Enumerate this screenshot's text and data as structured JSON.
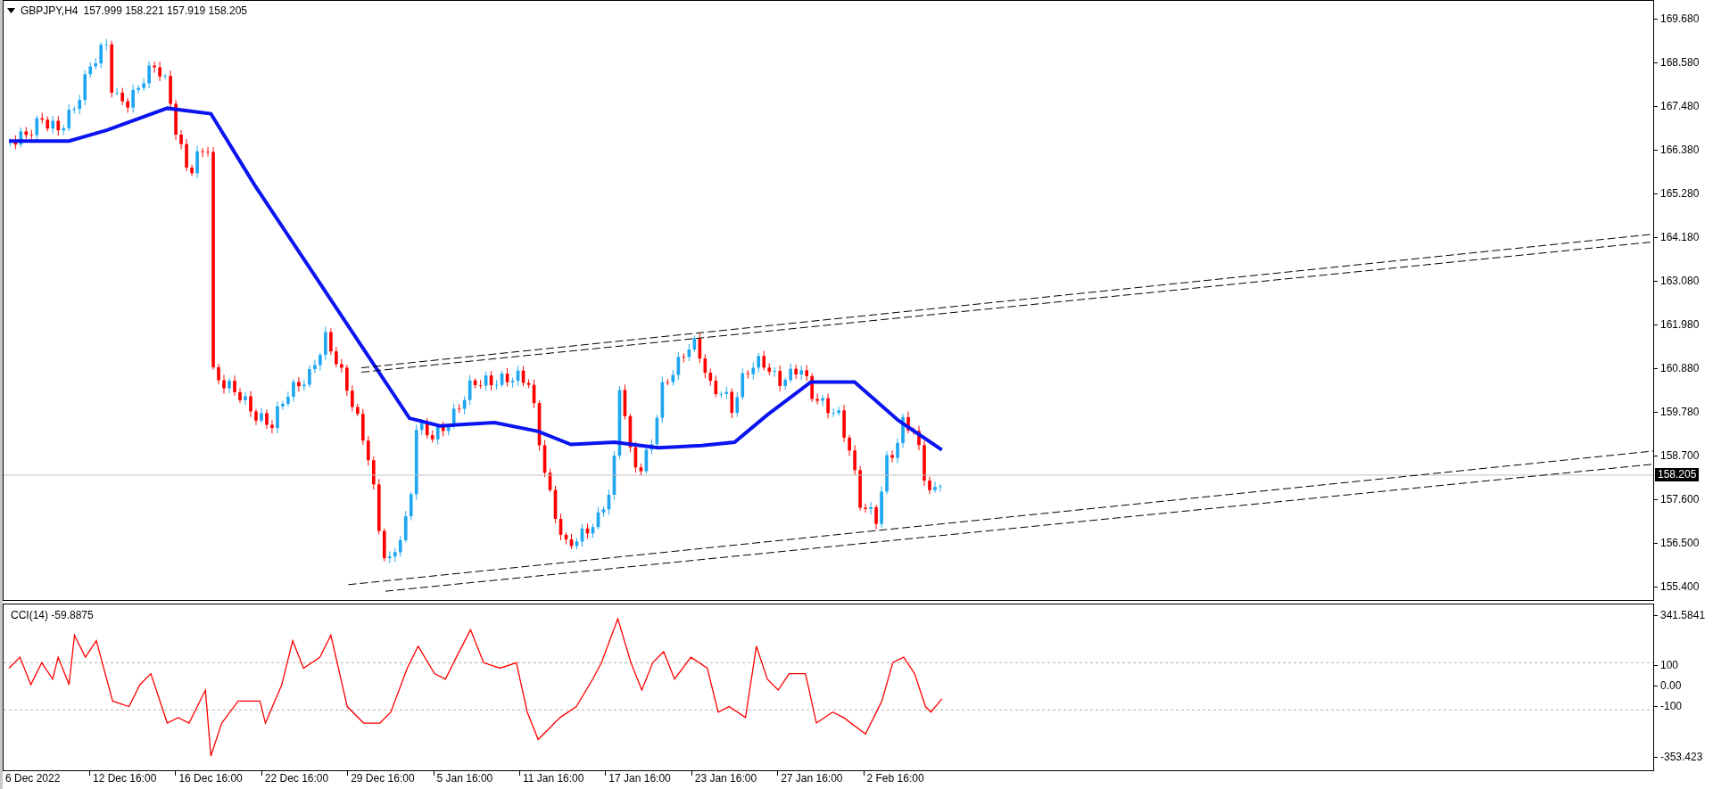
{
  "chart": {
    "symbol": "GBPJPY,H4",
    "ohlc": "157.999 158.221 157.919 158.205",
    "price_axis": [
      "169.680",
      "168.580",
      "167.480",
      "166.380",
      "165.280",
      "164.180",
      "163.080",
      "161.980",
      "160.880",
      "159.780",
      "158.700",
      "157.600",
      "156.500",
      "155.400"
    ],
    "current_price": "158.205"
  },
  "indicator": {
    "label": "CCI(14) -59.8875",
    "axis": [
      "341.5841",
      "100",
      "0.00",
      "-100",
      "-353.423"
    ]
  },
  "time_axis": [
    "6 Dec 2022",
    "12 Dec 16:00",
    "16 Dec 16:00",
    "22 Dec 16:00",
    "29 Dec 16:00",
    "5 Jan 16:00",
    "11 Jan 16:00",
    "17 Jan 16:00",
    "23 Jan 16:00",
    "27 Jan 16:00",
    "2 Feb 16:00"
  ]
}
